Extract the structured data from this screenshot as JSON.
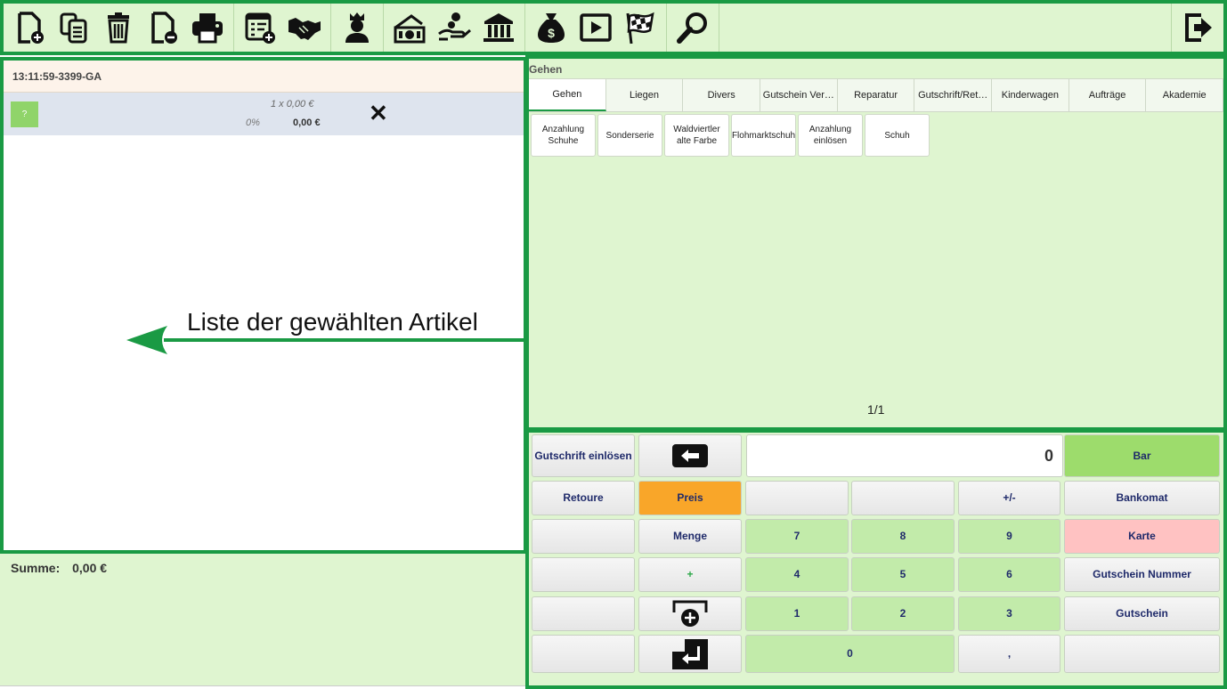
{
  "toolbar": {
    "groups": [
      [
        "new-document-icon",
        "copy-document-icon",
        "trash-icon",
        "remove-document-icon",
        "printer-icon"
      ],
      [
        "add-list-icon",
        "handshake-icon"
      ],
      [
        "crown-person-icon"
      ],
      [
        "cash-register-icon",
        "hand-coin-icon",
        "bank-icon"
      ],
      [
        "money-bag-icon",
        "play-icon",
        "checkered-flag-icon"
      ],
      [
        "magnifier-icon"
      ]
    ],
    "logout_icon": "logout-icon",
    "accent": "#1a9a44"
  },
  "document": {
    "id": "13:11:59-3399-GA",
    "item": {
      "badge": "?",
      "qty_line": "1 x  0,00 €",
      "percent": "0%",
      "total": "0,00 €",
      "delete": "✕"
    }
  },
  "annotation": "Liste der gewählten Artikel",
  "summary": {
    "label": "Summe:",
    "value": "0,00 €"
  },
  "products": {
    "category_title": "Gehen",
    "tabs": [
      "Gehen",
      "Liegen",
      "Divers",
      "Gutschein Ver…",
      "Reparatur",
      "Gutschrift/Ret…",
      "Kinderwagen",
      "Aufträge",
      "Akademie"
    ],
    "items": [
      "Anzahlung Schuhe",
      "Sonderserie",
      "Waldviertler alte Farbe",
      "Flohmarktschuh",
      "Anzahlung einlösen",
      "Schuh"
    ],
    "page": "1/1"
  },
  "keypad": {
    "display_value": "0",
    "gutschrift": "Gutschrift einlösen",
    "retoure": "Retoure",
    "preis": "Preis",
    "menge": "Menge",
    "plus": "+",
    "plusminus": "+/-",
    "bar": "Bar",
    "bankomat": "Bankomat",
    "karte": "Karte",
    "gutschein_nummer": "Gutschein Nummer",
    "gutschein": "Gutschein",
    "digits": {
      "d7": "7",
      "d8": "8",
      "d9": "9",
      "d4": "4",
      "d5": "5",
      "d6": "6",
      "d1": "1",
      "d2": "2",
      "d3": "3",
      "d0": "0",
      "comma": ","
    }
  }
}
